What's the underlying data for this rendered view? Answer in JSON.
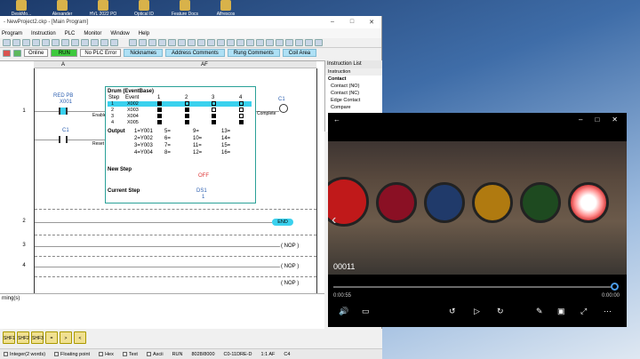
{
  "desktop": {
    "icons": [
      "DeskMo...",
      "Alexander",
      "HVL 2022 PO",
      "Optical ID",
      "Feature Docs",
      "Alfrescos"
    ]
  },
  "app": {
    "title": "- NewProject2.ckp - [Main Program]",
    "menu": [
      "Program",
      "Instruction",
      "PLC",
      "Monitor",
      "Window",
      "Help"
    ],
    "status": {
      "online": "Online",
      "run": "RUN",
      "plc_error": "No PLC Error"
    },
    "tabs": [
      "Nicknames",
      "Address Comments",
      "Rung Comments",
      "Coil Area"
    ],
    "columns": {
      "a": "A",
      "af": "AF"
    },
    "rungs": [
      "1",
      "2",
      "3",
      "4"
    ],
    "contact1": {
      "nick": "RED PB",
      "addr": "X001"
    },
    "contact2": {
      "addr": "C1"
    },
    "side_labels": {
      "enable": "Enable",
      "reset": "Reset"
    },
    "drum": {
      "header": "Drum (EventBase)",
      "step_col": "Step",
      "event_col": "Event",
      "col_nums": [
        "1",
        "2",
        "3",
        "4"
      ],
      "rows": [
        {
          "step": "1",
          "event": "X002"
        },
        {
          "step": "2",
          "event": "X003"
        },
        {
          "step": "3",
          "event": "X004"
        },
        {
          "step": "4",
          "event": "X005"
        }
      ],
      "output_label": "Output",
      "outputs": [
        [
          "1=Y001",
          "5=",
          "9=",
          "13="
        ],
        [
          "2=Y002",
          "6=",
          "10=",
          "14="
        ],
        [
          "3=Y003",
          "7=",
          "11=",
          "15="
        ],
        [
          "4=Y004",
          "8=",
          "12=",
          "16="
        ]
      ],
      "new_step_label": "New Step",
      "new_step_value": "OFF",
      "current_step_label": "Current Step",
      "current_step_addr": "DS1",
      "current_step_value": "1"
    },
    "coil": {
      "addr": "C1",
      "complete": "Complete"
    },
    "end_label": "END",
    "nop": "( NOP )",
    "instruction_panel": {
      "title": "Instruction List",
      "tab": "Instruction",
      "group": "Contact",
      "items": [
        "Contact (NO)",
        "Contact (NC)",
        "Edge Contact",
        "Compare"
      ]
    },
    "output_window": "rning(s)",
    "bottom_buttons": [
      "SHF1",
      "SHF2",
      "SHF3",
      "=",
      ">",
      "<"
    ],
    "statusbar": {
      "integer": "Integer(2 words)",
      "float": "Floating point",
      "hex": "Hex",
      "text": "Text",
      "ascii": "Ascii",
      "run": "RUN",
      "mem": "8028/8000",
      "model": "C0-11DRE-D",
      "pos": "1:1 AF",
      "cap": "C4"
    }
  },
  "player": {
    "timecode": "00011",
    "elapsed": "0:00:55",
    "remaining": "0:00:00",
    "progress": 1.0,
    "button_colors": [
      "#c0191a",
      "#8a1024",
      "#203a6a",
      "#b07a10",
      "#1e4a20",
      "#ffffff"
    ]
  }
}
